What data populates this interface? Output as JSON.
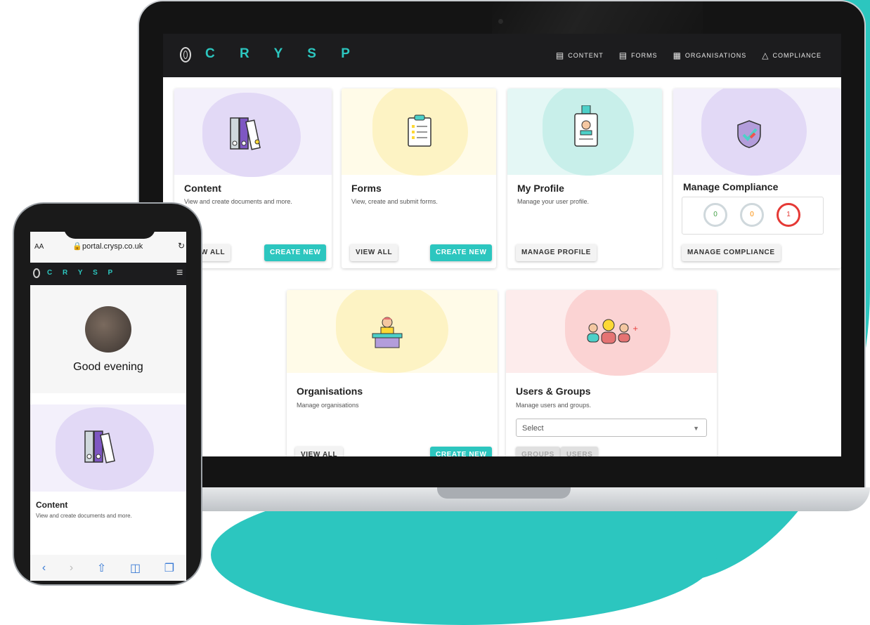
{
  "app": {
    "brand": "C R Y S P",
    "accent": "#2cc6bf"
  },
  "nav": {
    "items": [
      {
        "label": "CONTENT",
        "icon": "document-icon"
      },
      {
        "label": "FORMS",
        "icon": "clipboard-icon"
      },
      {
        "label": "ORGANISATIONS",
        "icon": "building-icon"
      },
      {
        "label": "COMPLIANCE",
        "icon": "network-icon"
      }
    ]
  },
  "cards": {
    "content": {
      "title": "Content",
      "desc": "View and create documents and more.",
      "btn_view": "VIEW ALL",
      "btn_create": "CREATE NEW"
    },
    "forms": {
      "title": "Forms",
      "desc": "View, create and submit forms.",
      "btn_view": "VIEW ALL",
      "btn_create": "CREATE NEW"
    },
    "profile": {
      "title": "My Profile",
      "desc": "Manage your user profile.",
      "btn_manage": "MANAGE PROFILE"
    },
    "compliance": {
      "title": "Manage Compliance",
      "btn_manage": "MANAGE COMPLIANCE",
      "gauges": [
        "0",
        "0",
        "1"
      ]
    },
    "organisations": {
      "title": "Organisations",
      "desc": "Manage organisations",
      "btn_view": "VIEW ALL",
      "btn_create": "CREATE NEW"
    },
    "users": {
      "title": "Users & Groups",
      "desc": "Manage users and groups.",
      "select": "Select",
      "btn_groups": "GROUPS",
      "btn_users": "USERS"
    }
  },
  "phone": {
    "aa": "AA",
    "url": "portal.crysp.co.uk",
    "brand": "C R Y S P",
    "greeting": "Good evening",
    "card_title": "Content",
    "card_desc": "View and create documents and more."
  }
}
